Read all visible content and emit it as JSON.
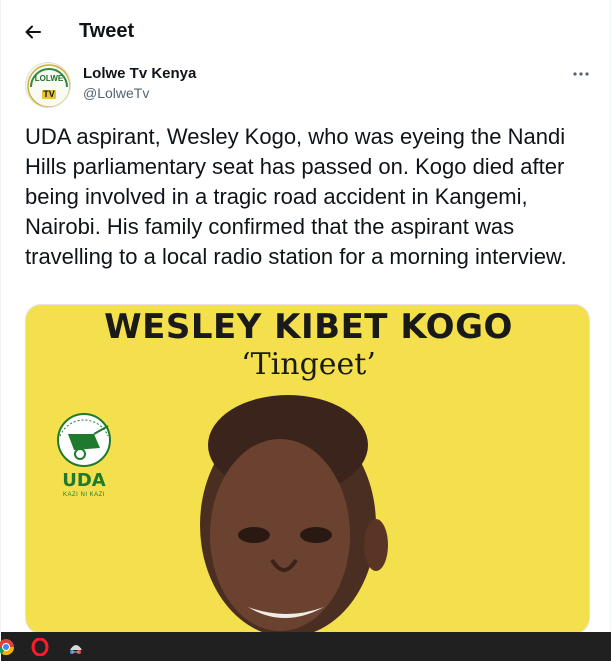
{
  "header": {
    "title": "Tweet",
    "back_icon": "back-arrow-icon"
  },
  "author": {
    "name": "Lolwe Tv Kenya",
    "handle": "@LolweTv",
    "avatar_text_top": "LOLWE",
    "avatar_text_bottom": "TV"
  },
  "tweet": {
    "text": "UDA aspirant, Wesley Kogo, who was eyeing the Nandi Hills parliamentary seat has passed on. Kogo died after being involved in a tragic road accident in Kangemi, Nairobi. His family confirmed that the aspirant was travelling to a local radio station for a morning interview."
  },
  "media": {
    "poster_name": "WESLEY KIBET KOGO",
    "poster_nickname": "‘Tingeet’",
    "party_name": "UDA",
    "party_motto": "KAZI NI KAZI",
    "background_color": "#f4e04d"
  },
  "taskbar": {
    "icons": [
      "chrome-icon",
      "opera-icon",
      "network-icon"
    ]
  },
  "colors": {
    "text_primary": "#0f1419",
    "text_secondary": "#536471",
    "party_green": "#1f7a2e"
  }
}
